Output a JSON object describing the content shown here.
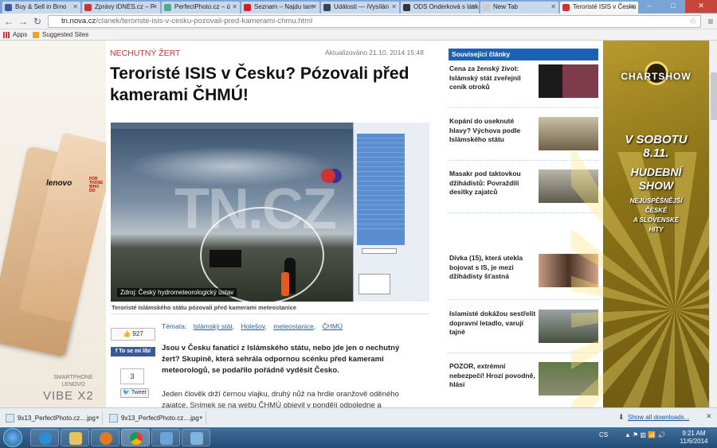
{
  "browser": {
    "tabs": [
      {
        "label": "Buy & Sell in Brno",
        "color": "#3b5998"
      },
      {
        "label": "Zprávy iDNES.cz – P",
        "color": "#c33"
      },
      {
        "label": "PerfectPhoto.cz – ú",
        "color": "#5a8"
      },
      {
        "label": "Seznam – Najdu tam",
        "color": "#c22"
      },
      {
        "label": "Události — iVysílán",
        "color": "#345"
      },
      {
        "label": "ODS Onderková s láskou",
        "color": "#333"
      },
      {
        "label": "New Tab",
        "color": "#ccc"
      },
      {
        "label": "Teroristé ISIS v Česku",
        "color": "#c33"
      }
    ],
    "url_domain": "tn.nova.cz",
    "url_path": "/clanek/teroriste-isis-v-cesku-pozovali-pred-kamerami-chmu.html",
    "bookmarks": {
      "apps": "Apps",
      "suggested": "Suggested Sites"
    }
  },
  "ad_left": {
    "brand": "lenovo",
    "tag": "FOR THOSE WHO DO",
    "line1": "SMARTPHONE",
    "line2": "LENOVO",
    "model": "VIBE X2"
  },
  "article": {
    "category": "NECHUTNÝ ŽERT",
    "updated": "Aktualizováno 21.10. 2014 15:48",
    "headline": "Teroristé ISIS v Česku? Pózovali před kamerami ČHMÚ!",
    "photo_watermark": "TN.CZ",
    "photo_credit": "Zdroj: Český hydrometeorologický ústav",
    "caption": "Teroristé Islámského státu pózovali před kamerami meteostanice",
    "likes": "927",
    "share_label": "To se mi líbí",
    "tweets": "3",
    "tweet_label": "Tweet",
    "topics_label": "Témata:",
    "topics": [
      "Islámský stát",
      "Holešov",
      "meteostanice",
      "ČHMÚ"
    ],
    "lead": "Jsou v Česku fanatici z Islámského státu, nebo jde jen o nechutný žert? Skupině, která sehrála odpornou scénku před kamerami meteorologů, se podařilo pořádně vyděsit Česko.",
    "body": "Jeden člověk drží černou vlajku, druhý nůž na hrdle oranžově oděného zajatce. Snímek se na webu ČHMÚ objevil v pondělí odpoledne a rychle"
  },
  "sidebar": {
    "title": "Související články",
    "items": [
      {
        "title": "Cena za ženský život: Islámský stát zveřejnil ceník otroků",
        "img": "#2d2a28"
      },
      {
        "title": "Kopání do useknuté hlavy? Výchova podle Islámského státu",
        "img": "#8a7b5c"
      },
      {
        "title": "Masakr pod taktovkou džihádistů: Povraždili desítky zajatců",
        "img": "#9a9480"
      },
      {
        "title": "Dívka (15), která utekla bojovat s IS, je mezi džihádisty šťastná",
        "img": "#b0836a"
      },
      {
        "title": "Islamisté dokážou sestřelit dopravní letadlo, varují tajné",
        "img": "#7c7f70"
      },
      {
        "title": "POZOR, extrémní nebezpečí! Hrozí povodně, hlásí",
        "img": "#6b7a52"
      }
    ]
  },
  "ad_right": {
    "brand": "CHARTSHOW",
    "line1": "V SOBOTU",
    "line2": "8.11.",
    "line3": "HUDEBNÍ",
    "line4": "SHOW",
    "line5": "NEJÚSPĚŠNĚJŠÍ",
    "line6": "ČESKÉ",
    "line7": "A SLOVENSKÉ",
    "line8": "HITY"
  },
  "downloads": {
    "items": [
      "9x13_PerfectPhoto.cz....jpg",
      "9x13_PerfectPhoto.cz....jpg"
    ],
    "show_all": "Show all downloads..."
  },
  "taskbar": {
    "lang": "CS",
    "time": "9:21 AM",
    "date": "11/6/2014"
  }
}
